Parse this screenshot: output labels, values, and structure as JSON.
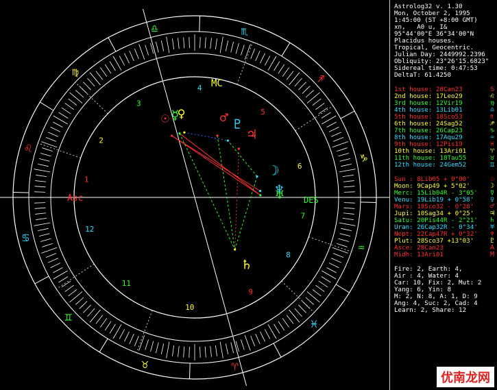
{
  "app": {
    "name": "Astrolog32 v. 1.30",
    "date": "Mon, October 2, 1995",
    "time": "1:45:00 (ST +8:00 GMT)",
    "place_line": "xn,   A0 u, I&",
    "coords": "95°44'00\"E 36°34'00\"N",
    "house_system": "Placidus houses.",
    "zodiac": "Tropical, Geocentric.",
    "julian": "Julian Day: 2449992.2396",
    "obliquity": "Obliquity: 23°26'15.6823\"",
    "sidereal": "Sidereal time: 0:47:53",
    "delta": "DeltaT: 61.4250"
  },
  "houses": [
    {
      "label": "1st house:",
      "value": "28Can23",
      "color": "#ff3030",
      "glyph": "♋"
    },
    {
      "label": "2nd house:",
      "value": "17Leo29",
      "color": "#ffff30",
      "glyph": "♌"
    },
    {
      "label": "3rd house:",
      "value": "12Vir19",
      "color": "#30ff30",
      "glyph": "♍"
    },
    {
      "label": "4th house:",
      "value": "13Lib01",
      "color": "#30e0ff",
      "glyph": "♎"
    },
    {
      "label": "5th house:",
      "value": "18Sco53",
      "color": "#ff3030",
      "glyph": "♏"
    },
    {
      "label": "6th house:",
      "value": "24Sag52",
      "color": "#ffff30",
      "glyph": "♐"
    },
    {
      "label": "7th house:",
      "value": "26Cap23",
      "color": "#30ff30",
      "glyph": "♑"
    },
    {
      "label": "8th house:",
      "value": "17Aqu29",
      "color": "#30e0ff",
      "glyph": "♒"
    },
    {
      "label": "9th house:",
      "value": "12Pis19",
      "color": "#ff3030",
      "glyph": "♓"
    },
    {
      "label": "10th house:",
      "value": "13Ari01",
      "color": "#ffff30",
      "glyph": "♈"
    },
    {
      "label": "11th house:",
      "value": "18Tau55",
      "color": "#30ff30",
      "glyph": "♉"
    },
    {
      "label": "12th house:",
      "value": "24Gem52",
      "color": "#30e0ff",
      "glyph": "♊"
    }
  ],
  "planets": [
    {
      "name": "Sun :",
      "pos": "8Lib05",
      "lat": "+ 0°00'",
      "color": "#ff3030",
      "glyph": "☉"
    },
    {
      "name": "Moon:",
      "pos": "9Cap49",
      "lat": "+ 5°02'",
      "color": "#ffff30",
      "glyph": "☽"
    },
    {
      "name": "Merc:",
      "pos": "15Lib04R",
      "lat": "- 3°05'",
      "color": "#30ff30",
      "glyph": "☿"
    },
    {
      "name": "Venu:",
      "pos": "19Lib19",
      "lat": "+ 0°58'",
      "color": "#30e0ff",
      "glyph": "♀"
    },
    {
      "name": "Mars:",
      "pos": "18Sco32",
      "lat": "- 0°28'",
      "color": "#ff3030",
      "glyph": "♂"
    },
    {
      "name": "Jupi:",
      "pos": "10Sag34",
      "lat": "+ 0°25'",
      "color": "#ffff30",
      "glyph": "♃"
    },
    {
      "name": "Satu:",
      "pos": "20Pis44R",
      "lat": "- 2°21'",
      "color": "#30ff30",
      "glyph": "♄"
    },
    {
      "name": "Uran:",
      "pos": "26Cap32R",
      "lat": "- 0°34'",
      "color": "#30e0ff",
      "glyph": "♅"
    },
    {
      "name": "Nept:",
      "pos": "22Cap47R",
      "lat": "+ 0°32'",
      "color": "#ff3030",
      "glyph": "♆"
    },
    {
      "name": "Plut:",
      "pos": "28Sco37",
      "lat": "+13°03'",
      "color": "#ffff30",
      "glyph": "♇"
    },
    {
      "name": "Asce:",
      "pos": "28Can23",
      "lat": "",
      "color": "#ff3030",
      "glyph": "A"
    },
    {
      "name": "Midh:",
      "pos": "13Ari01",
      "lat": "",
      "color": "#ff3030",
      "glyph": "M"
    }
  ],
  "summary": [
    "Fire: 2, Earth: 4,",
    "Air : 4, Water: 4",
    "Car: 10, Fix: 2, Mut: 2",
    "Yang: 6, Yin: 8",
    "M: 2, N: 8, A: 1, D: 9",
    "Ang: 4, Suc: 2, Cad: 4",
    "Learn: 2, Share: 12"
  ],
  "chart_labels": {
    "asc": "Asc",
    "des": "DES",
    "mc": "MC",
    "house_numbers": [
      "1",
      "2",
      "3",
      "4",
      "5",
      "6",
      "7",
      "8",
      "9",
      "10",
      "11",
      "12"
    ]
  },
  "watermark": "优南龙网",
  "colors": {
    "red": "#ff3030",
    "yellow": "#ffff30",
    "green": "#30ff30",
    "cyan": "#30e0ff",
    "blue": "#4060ff",
    "white": "#ffffff"
  }
}
